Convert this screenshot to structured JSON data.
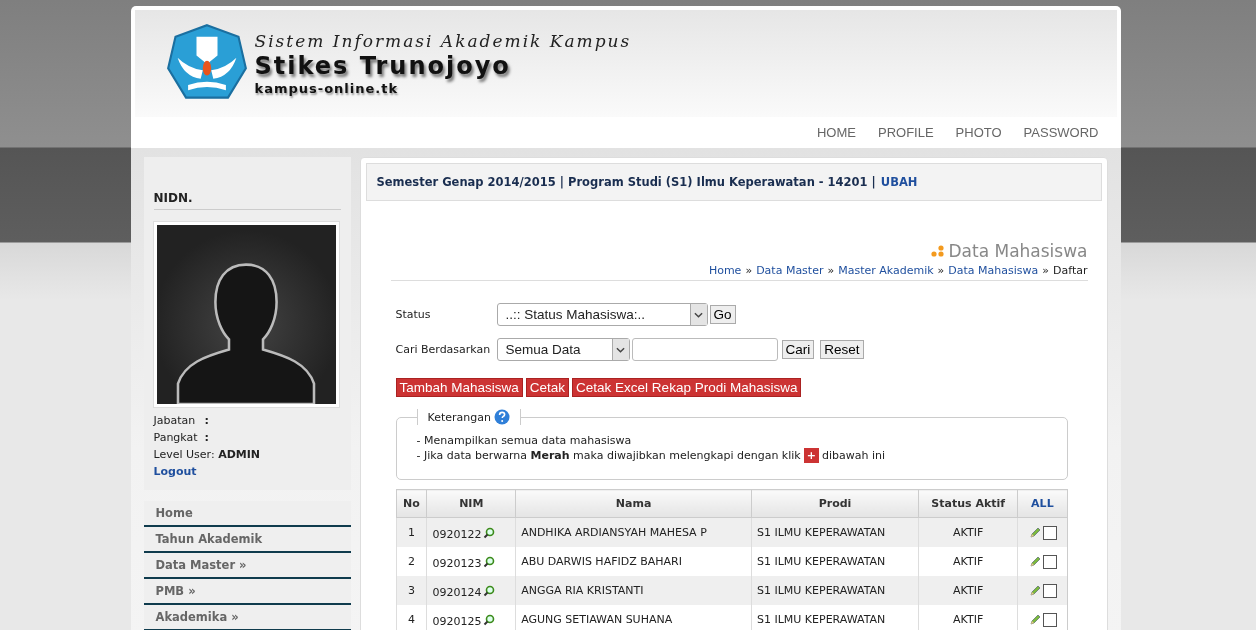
{
  "header": {
    "tagline": "Sistem Informasi Akademik Kampus",
    "title": "Stikes Trunojoyo",
    "domain": "kampus-online.tk"
  },
  "top_nav": [
    {
      "label": "HOME"
    },
    {
      "label": "PROFILE"
    },
    {
      "label": "PHOTO"
    },
    {
      "label": "PASSWORD"
    }
  ],
  "sidebar": {
    "heading": "NIDN.",
    "fields": [
      {
        "label": "Jabatan",
        "colon": ":"
      },
      {
        "label": "Pangkat",
        "colon": ":"
      }
    ],
    "level_user": "Level User: **ADMIN**",
    "logout": "Logout",
    "menu": [
      {
        "label": "Home"
      },
      {
        "label": "Tahun Akademik"
      },
      {
        "label": "Data Master »"
      },
      {
        "label": "PMB »"
      },
      {
        "label": "Akademika »"
      }
    ]
  },
  "info_bar": {
    "text": "Semester Genap 2014/2015 | Program Studi (S1) Ilmu Keperawatan - 14201 |",
    "link": "UBAH"
  },
  "page_title": "Data Mahasiswa",
  "breadcrumb": {
    "links": [
      "Home",
      "Data Master",
      "Master Akademik",
      "Data Mahasiswa"
    ],
    "separator": "»",
    "current": "Daftar"
  },
  "filters": [
    {
      "kind": "status",
      "label": "Status",
      "select": "..:: Status Mahasiswa:..",
      "buttons": [
        "Go"
      ]
    },
    {
      "kind": "search",
      "label": "Cari Berdasarkan",
      "select": "Semua Data",
      "buttons": [
        "Cari",
        "Reset"
      ]
    }
  ],
  "actions": [
    "Tambah Mahasiswa",
    "Cetak",
    "Cetak Excel Rekap Prodi Mahasiswa"
  ],
  "keterangan": {
    "legend": "Keterangan",
    "line_1": "- Menampilkan semua data mahasiswa",
    "line_2": "- Jika data berwarna **Merah** maka diwajibkan melengkapi dengan klik",
    "badge": "+",
    "line_2_end": "dibawah ini"
  },
  "table": {
    "columns": [
      "No",
      "NIM",
      "Nama",
      "Prodi",
      "Status Aktif",
      "ALL"
    ],
    "rows": [
      {
        "no": "1",
        "nim": "0920122",
        "nama": "ANDHIKA ARDIANSYAH MAHESA P",
        "prodi": "S1 ILMU KEPERAWATAN",
        "status": "AKTIF",
        "checked": false
      },
      {
        "no": "2",
        "nim": "0920123",
        "nama": "ABU DARWIS HAFIDZ BAHARI",
        "prodi": "S1 ILMU KEPERAWATAN",
        "status": "AKTIF",
        "checked": false
      },
      {
        "no": "3",
        "nim": "0920124",
        "nama": "ANGGA RIA KRISTANTI",
        "prodi": "S1 ILMU KEPERAWATAN",
        "status": "AKTIF",
        "checked": false
      },
      {
        "no": "4",
        "nim": "0920125",
        "nama": "AGUNG SETIAWAN SUHANA",
        "prodi": "S1 ILMU KEPERAWATAN",
        "status": "AKTIF",
        "checked": false
      }
    ]
  }
}
